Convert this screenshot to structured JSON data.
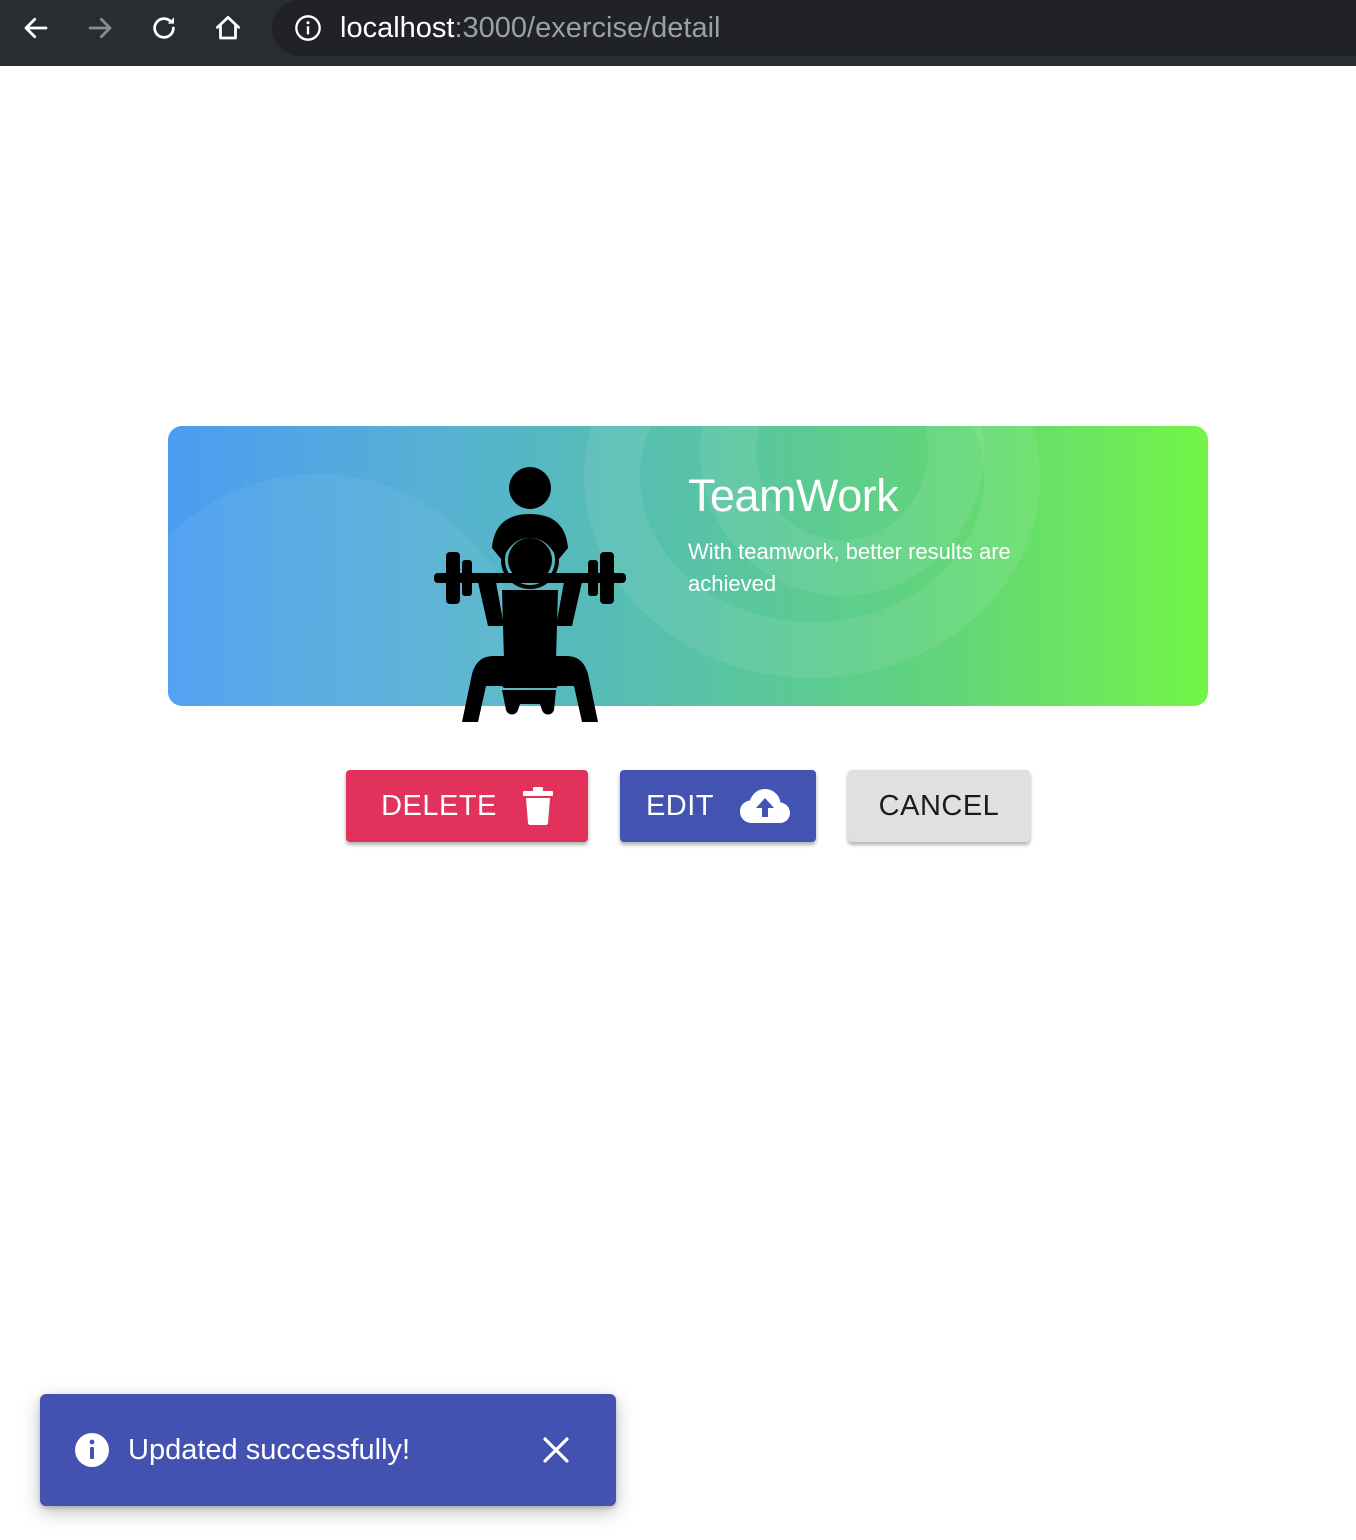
{
  "browser": {
    "url_host": "localhost",
    "url_path": ":3000/exercise/detail",
    "icons": {
      "back": "arrow-left-icon",
      "forward": "arrow-right-icon",
      "reload": "reload-icon",
      "home": "home-icon",
      "site_info": "info-icon"
    }
  },
  "card": {
    "title": "TeamWork",
    "subtitle": "With teamwork, better results are achieved",
    "gradient_start": "#4b9df2",
    "gradient_end": "#72f547",
    "image_icon": "weightlifting-pair-icon"
  },
  "actions": {
    "delete_label": "DELETE",
    "delete_icon": "trash-icon",
    "delete_color": "#e2315b",
    "edit_label": "EDIT",
    "edit_icon": "cloud-upload-icon",
    "edit_color": "#4353b2",
    "cancel_label": "CANCEL",
    "cancel_color": "#e0e0e0"
  },
  "snackbar": {
    "message": "Updated successfully!",
    "icon": "info-icon",
    "close_icon": "close-icon",
    "color": "#4352b1"
  }
}
